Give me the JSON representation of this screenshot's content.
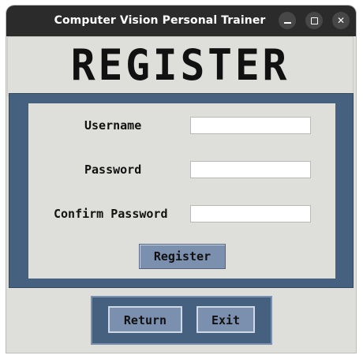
{
  "window": {
    "title": "Computer Vision Personal Trainer",
    "controls": [
      "minimize-icon",
      "maximize-icon",
      "close-icon"
    ]
  },
  "header": {
    "title": "REGISTER"
  },
  "form": {
    "username_label": "Username",
    "username_value": "",
    "password_label": "Password",
    "password_value": "",
    "confirm_label": "Confirm Password",
    "confirm_value": "",
    "register_button": "Register"
  },
  "footer": {
    "return_button": "Return",
    "exit_button": "Exit"
  },
  "colors": {
    "panel_blue": "#46607f",
    "button_blue": "#7b8fae",
    "background": "#dededa",
    "titlebar": "#2b2b2b"
  }
}
